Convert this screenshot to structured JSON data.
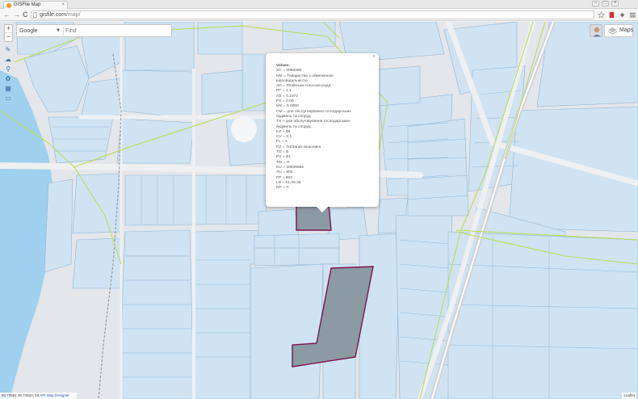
{
  "browser": {
    "tab_title": "GISFile Map",
    "tab_close": "×",
    "url_host": "gisfile.com",
    "url_path": "/map/",
    "win_min": "–",
    "win_max": "□",
    "win_close": "×",
    "back_glyph": "←",
    "forward_glyph": "→",
    "reload_glyph": "C"
  },
  "map": {
    "zoom_in": "+",
    "zoom_out": "−",
    "search": {
      "engine": "Google",
      "engine_arrow": "▼",
      "placeholder": "Find"
    },
    "layers_button": "Maps",
    "popup": {
      "close": "×",
      "heading": "Values:",
      "lines": [
        "SC = 0080080",
        "NM = Товариство з обмеженою",
        "відповідальністю",
        "AD = Літківська сільська рада",
        "PF = 1.1",
        "AS = 0.1072",
        "PS = 0.00",
        "MS = 0.0000",
        "CM = для обслуговування господарських",
        "будівель та споруд",
        "TX = для обслуговування господарських",
        "будівель та споруд",
        "KZ = 58",
        "CV = 2.1",
        "FL = 1",
        "PZ = 7Н/Запис власника",
        "TD = B",
        "PV = B1",
        "TM = H",
        "KU = 30839555",
        "AU = 804",
        "FP = 804",
        "LS = 01.09.35",
        "NP = 0"
      ]
    },
    "status": {
      "coords": "50.73591 30.74542; 18",
      "link_api": "API",
      "link_designer": "Map Designer"
    },
    "attribution": "Leaflet",
    "colors": {
      "water": "#9fd0ee",
      "parcel_fill": "#cfe3f2",
      "parcel_stroke": "#8fb6d8",
      "road": "#e6e8eb",
      "boundary": "#b7dd5a",
      "selected_fill": "#8c9aa3",
      "selected_stroke": "#7a1550"
    },
    "icons": {
      "tools": [
        "ruler-icon",
        "draw-icon",
        "search-icon",
        "locate-icon",
        "layers-icon",
        "comment-icon"
      ],
      "browser": [
        "star-icon",
        "bookmark-icon",
        "extension-icon",
        "menu-icon"
      ]
    }
  }
}
